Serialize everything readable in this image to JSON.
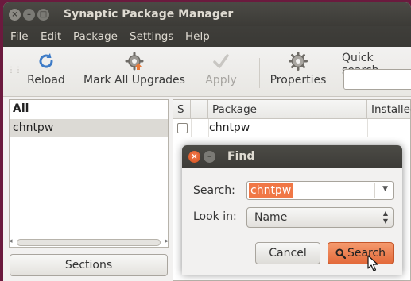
{
  "window": {
    "title": "Synaptic Package Manager",
    "controls": {
      "close": "×",
      "minimize": "–",
      "maximize": "□"
    }
  },
  "menubar": {
    "items": [
      "File",
      "Edit",
      "Package",
      "Settings",
      "Help"
    ]
  },
  "toolbar": {
    "reload": {
      "label": "Reload",
      "icon": "reload-icon"
    },
    "mark_all": {
      "label": "Mark All Upgrades",
      "icon": "gear-upgrade-icon"
    },
    "apply": {
      "label": "Apply",
      "icon": "checkmark-icon",
      "disabled": true
    },
    "properties": {
      "label": "Properties",
      "icon": "gear-icon"
    },
    "quick_search": {
      "label": "Quick search",
      "value": ""
    }
  },
  "filters": {
    "header": "All",
    "items": [
      "chntpw"
    ]
  },
  "sections_button": "Sections",
  "package_list": {
    "columns": [
      "S",
      "Package",
      "Installed"
    ],
    "rows": [
      {
        "status": false,
        "package": "chntpw"
      }
    ]
  },
  "find_dialog": {
    "title": "Find",
    "search_label": "Search:",
    "search_value": "chntpw",
    "look_in_label": "Look in:",
    "look_in_value": "Name",
    "cancel_label": "Cancel",
    "search_button_label": "Search"
  },
  "colors": {
    "accent": "#f07746",
    "titlebar": "#3c3b37",
    "desktop": "#6b1a3e"
  }
}
